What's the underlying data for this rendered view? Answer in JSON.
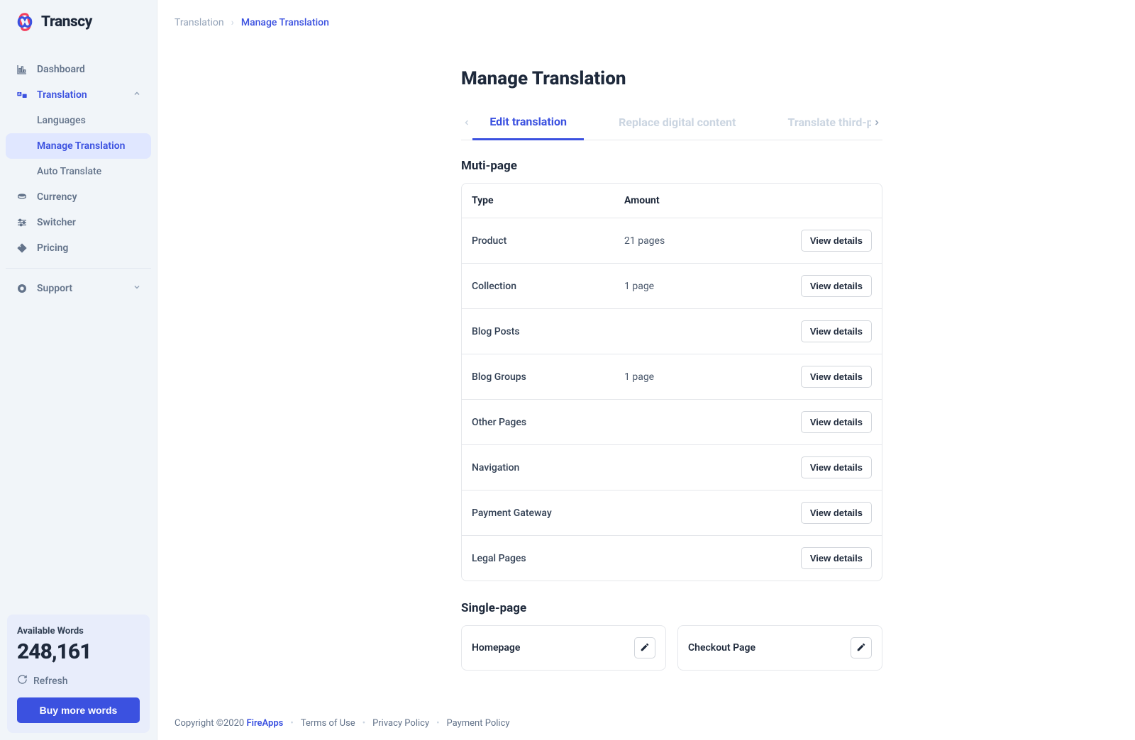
{
  "brand": {
    "name": "Transcy"
  },
  "sidebar": {
    "items": [
      {
        "label": "Dashboard"
      },
      {
        "label": "Translation"
      },
      {
        "label": "Currency"
      },
      {
        "label": "Switcher"
      },
      {
        "label": "Pricing"
      },
      {
        "label": "Support"
      }
    ],
    "translation_sub": [
      {
        "label": "Languages"
      },
      {
        "label": "Manage Translation"
      },
      {
        "label": "Auto Translate"
      }
    ]
  },
  "words_card": {
    "title": "Available Words",
    "count": "248,161",
    "refresh_label": "Refresh",
    "buy_label": "Buy more words"
  },
  "breadcrumb": {
    "a": "Translation",
    "b": "Manage Translation"
  },
  "page": {
    "title": "Manage Translation",
    "tabs": {
      "edit": "Edit translation",
      "replace": "Replace digital content",
      "third": "Translate third-party"
    },
    "multi_heading": "Muti-page",
    "single_heading": "Single-page"
  },
  "table": {
    "head_type": "Type",
    "head_amount": "Amount",
    "view": "View details",
    "rows": [
      {
        "type": "Product",
        "amount": "21 pages"
      },
      {
        "type": "Collection",
        "amount": "1 page"
      },
      {
        "type": "Blog Posts",
        "amount": ""
      },
      {
        "type": "Blog Groups",
        "amount": "1 page"
      },
      {
        "type": "Other Pages",
        "amount": ""
      },
      {
        "type": "Navigation",
        "amount": ""
      },
      {
        "type": "Payment Gateway",
        "amount": ""
      },
      {
        "type": "Legal Pages",
        "amount": ""
      }
    ]
  },
  "single": {
    "cards": [
      {
        "label": "Homepage"
      },
      {
        "label": "Checkout Page"
      }
    ]
  },
  "footer": {
    "copyright": "Copyright ©2020 ",
    "fire": "FireApps",
    "terms": "Terms of Use",
    "privacy": "Privacy Policy",
    "payment": "Payment Policy"
  }
}
